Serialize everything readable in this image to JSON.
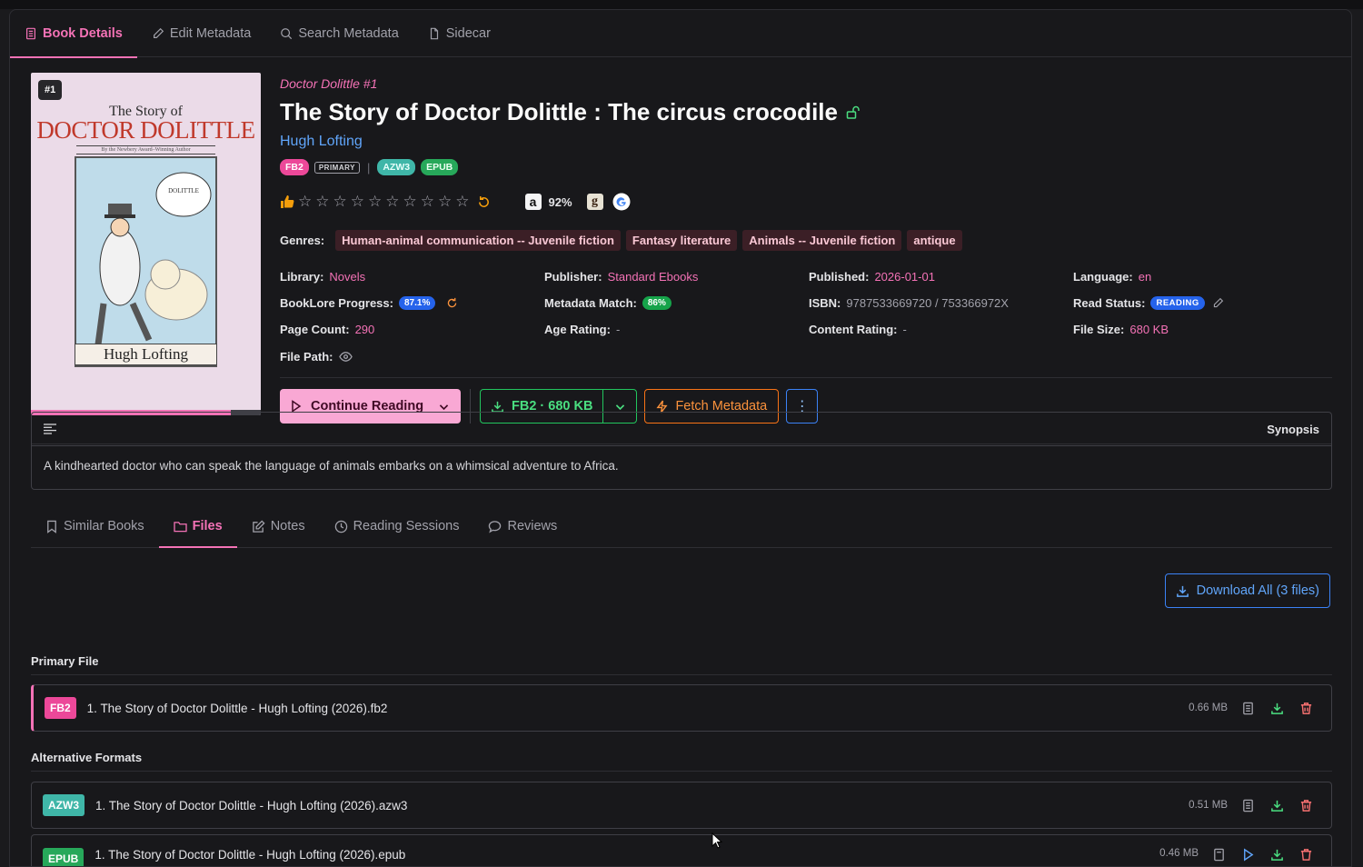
{
  "tabs": [
    {
      "label": "Book Details",
      "icon": "document-icon",
      "active": true
    },
    {
      "label": "Edit Metadata",
      "icon": "pencil-icon"
    },
    {
      "label": "Search Metadata",
      "icon": "search-icon"
    },
    {
      "label": "Sidecar",
      "icon": "file-icon"
    }
  ],
  "cover": {
    "badge": "#1",
    "title_line1": "The Story of",
    "title_line2": "DOCTOR DOLITTLE",
    "subtitle": "By the Newbery Award–Winning Author",
    "author": "Hugh Lofting",
    "progress": 0.871
  },
  "book": {
    "series": "Doctor Dolittle #1",
    "title": "The Story of Doctor Dolittle : The circus crocodile",
    "author": "Hugh Lofting",
    "formats": {
      "fb2": "FB2",
      "primary": "PRIMARY",
      "sep": "|",
      "azw3": "AZW3",
      "epub": "EPUB"
    },
    "amazon_pct": "92%",
    "genres_label": "Genres:",
    "genres": [
      "Human-animal communication -- Juvenile fiction",
      "Fantasy literature",
      "Animals -- Juvenile fiction",
      "antique"
    ]
  },
  "details": {
    "library_k": "Library:",
    "library_v": "Novels",
    "publisher_k": "Publisher:",
    "publisher_v": "Standard Ebooks",
    "published_k": "Published:",
    "published_v": "2026-01-01",
    "language_k": "Language:",
    "language_v": "en",
    "progress_k": "BookLore Progress:",
    "progress_v": "87.1%",
    "match_k": "Metadata Match:",
    "match_v": "86%",
    "isbn_k": "ISBN:",
    "isbn_v": "9787533669720 / 753366972X",
    "status_k": "Read Status:",
    "status_v": "READING",
    "pages_k": "Page Count:",
    "pages_v": "290",
    "age_k": "Age Rating:",
    "age_v": "-",
    "content_k": "Content Rating:",
    "content_v": "-",
    "size_k": "File Size:",
    "size_v": "680 KB",
    "path_k": "File Path:"
  },
  "actions": {
    "continue": "Continue Reading",
    "download": "FB2 · 680 KB",
    "fetch": "Fetch Metadata"
  },
  "synopsis": {
    "title": "Synopsis",
    "text": "A kindhearted doctor who can speak the language of animals embarks on a whimsical adventure to Africa."
  },
  "subtabs": [
    {
      "label": "Similar Books",
      "icon": "bookmark-icon"
    },
    {
      "label": "Files",
      "icon": "folder-icon",
      "active": true
    },
    {
      "label": "Notes",
      "icon": "edit-icon"
    },
    {
      "label": "Reading Sessions",
      "icon": "clock-icon"
    },
    {
      "label": "Reviews",
      "icon": "chat-icon"
    }
  ],
  "files": {
    "download_all": "Download All (3 files)",
    "primary_title": "Primary File",
    "alt_title": "Alternative Formats",
    "primary": {
      "tag": "FB2",
      "name": "1. The Story of Doctor Dolittle - Hugh Lofting (2026).fb2",
      "size": "0.66 MB"
    },
    "alt": [
      {
        "tag": "AZW3",
        "name": "1. The Story of Doctor Dolittle - Hugh Lofting (2026).azw3",
        "size": "0.51 MB"
      },
      {
        "tag": "EPUB",
        "name": "1. The Story of Doctor Dolittle - Hugh Lofting (2026).epub",
        "size": "0.46 MB"
      }
    ]
  },
  "colors": {
    "accent": "#f472b6",
    "blue": "#60a5fa",
    "green": "#22c55e",
    "orange": "#f97316"
  }
}
